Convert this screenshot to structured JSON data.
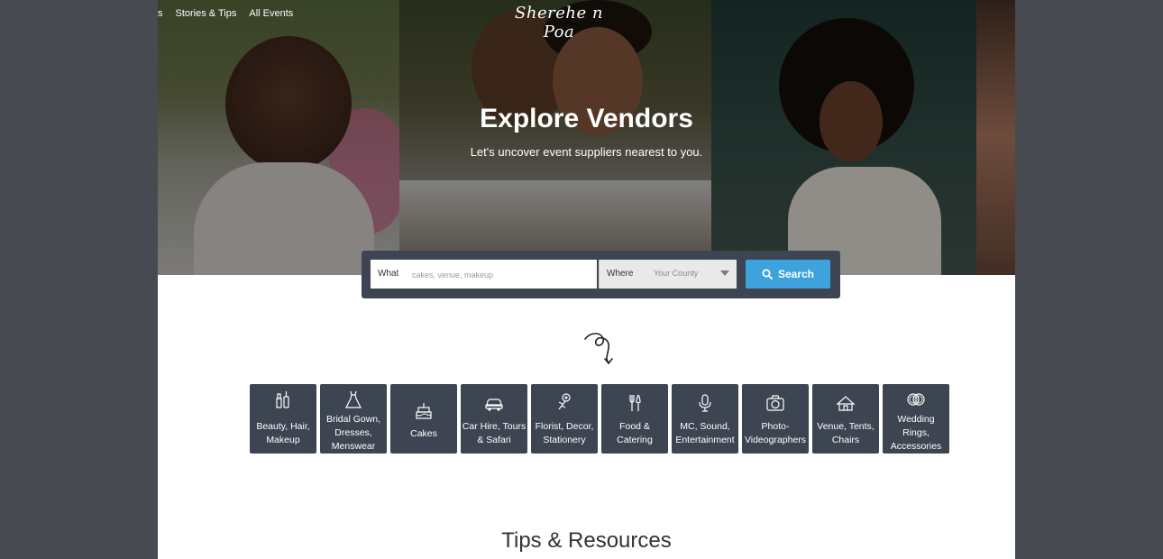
{
  "nav": {
    "items": [
      "s",
      "Stories & Tips",
      "All Events"
    ]
  },
  "logo": {
    "text": "Sherehe n Poa"
  },
  "hero": {
    "title": "Explore Vendors",
    "subtitle": "Let's uncover event suppliers nearest to you."
  },
  "search": {
    "what_label": "What",
    "what_placeholder": "cakes, venue, makeup",
    "what_value": "",
    "where_label": "Where",
    "where_value": "Your County",
    "button_label": "Search",
    "button_color": "#3ea3dc"
  },
  "categories": [
    {
      "icon": "makeup-icon",
      "lines": [
        "Beauty, Hair,",
        "Makeup"
      ]
    },
    {
      "icon": "gown-icon",
      "lines": [
        "Bridal Gown,",
        "Dresses,",
        "Menswear"
      ]
    },
    {
      "icon": "cake-icon",
      "lines": [
        "Cakes"
      ]
    },
    {
      "icon": "car-icon",
      "lines": [
        "Car Hire, Tours",
        "& Safari"
      ]
    },
    {
      "icon": "flower-icon",
      "lines": [
        "Florist, Decor,",
        "Stationery"
      ]
    },
    {
      "icon": "cutlery-icon",
      "lines": [
        "Food &",
        "Catering"
      ]
    },
    {
      "icon": "microphone-icon",
      "lines": [
        "MC, Sound,",
        "Entertainment"
      ]
    },
    {
      "icon": "camera-icon",
      "lines": [
        "Photo-",
        "Videographers"
      ]
    },
    {
      "icon": "tent-icon",
      "lines": [
        "Venue, Tents,",
        "Chairs"
      ]
    },
    {
      "icon": "rings-icon",
      "lines": [
        "Wedding",
        "Rings,",
        "Accessories"
      ]
    }
  ],
  "tips": {
    "title": "Tips & Resources"
  },
  "colors": {
    "tile_bg": "#3c4551",
    "page_bg": "#474a50"
  }
}
